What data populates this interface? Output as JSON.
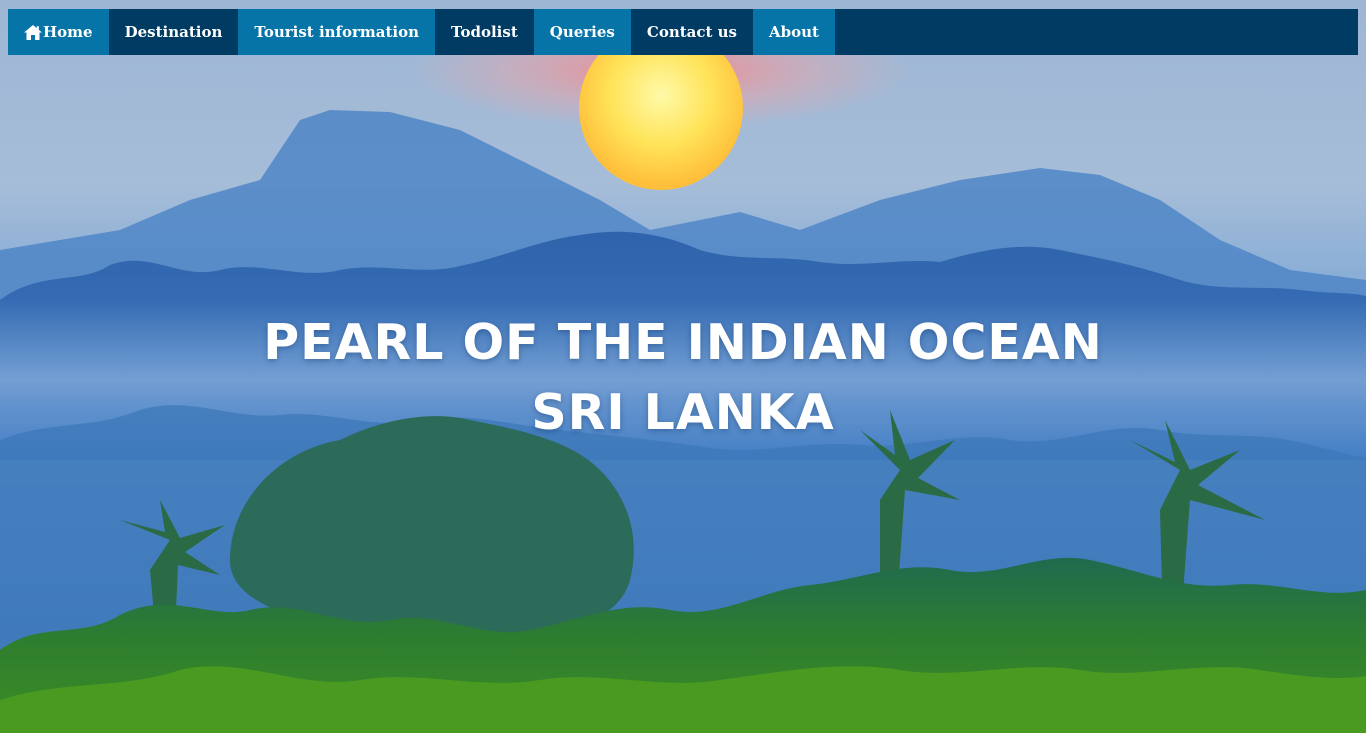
{
  "nav": {
    "items": [
      {
        "label": "Home",
        "icon": "home-icon"
      },
      {
        "label": "Destination"
      },
      {
        "label": "Tourist information"
      },
      {
        "label": "Todolist"
      },
      {
        "label": "Queries"
      },
      {
        "label": "Contact us"
      },
      {
        "label": "About"
      }
    ]
  },
  "hero": {
    "line1": "PEARL OF THE INDIAN OCEAN",
    "line2": "SRI LANKA"
  },
  "colors": {
    "nav_dark": "#003b64",
    "nav_light": "#0774a8",
    "text": "#ffffff"
  }
}
